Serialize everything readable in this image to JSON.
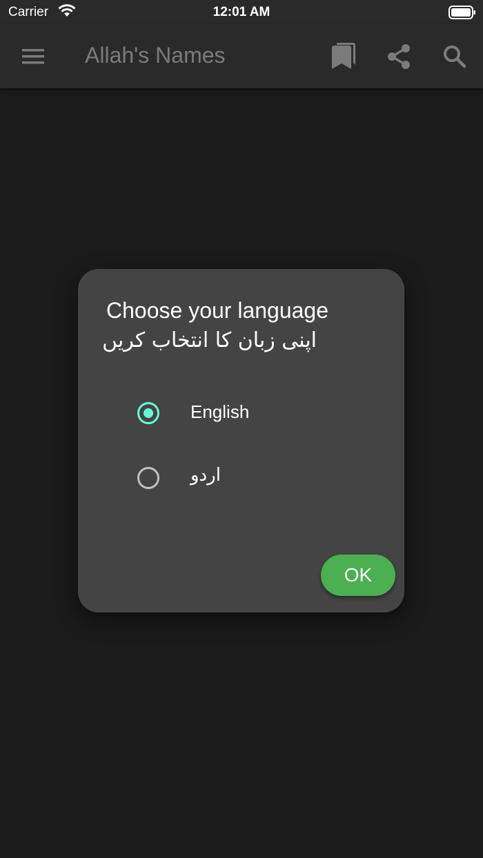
{
  "status_bar": {
    "carrier": "Carrier",
    "time": "12:01 AM"
  },
  "app_bar": {
    "title": "Allah's Names",
    "icons": [
      "menu-icon",
      "bookmark-icon",
      "share-icon",
      "search-icon"
    ]
  },
  "dialog": {
    "title": "Choose your language",
    "subtitle": "اپنی زبان کا انتخاب کریں",
    "options": [
      {
        "label": "English",
        "selected": true
      },
      {
        "label": "اردو",
        "selected": false
      }
    ],
    "ok_label": "OK"
  },
  "colors": {
    "background": "#1b1b1b",
    "app_bar": "#2a2a2a",
    "dialog": "#444444",
    "accent_radio": "#64ffda",
    "ok_button": "#4caf50",
    "title_text": "#7b7b7b"
  }
}
